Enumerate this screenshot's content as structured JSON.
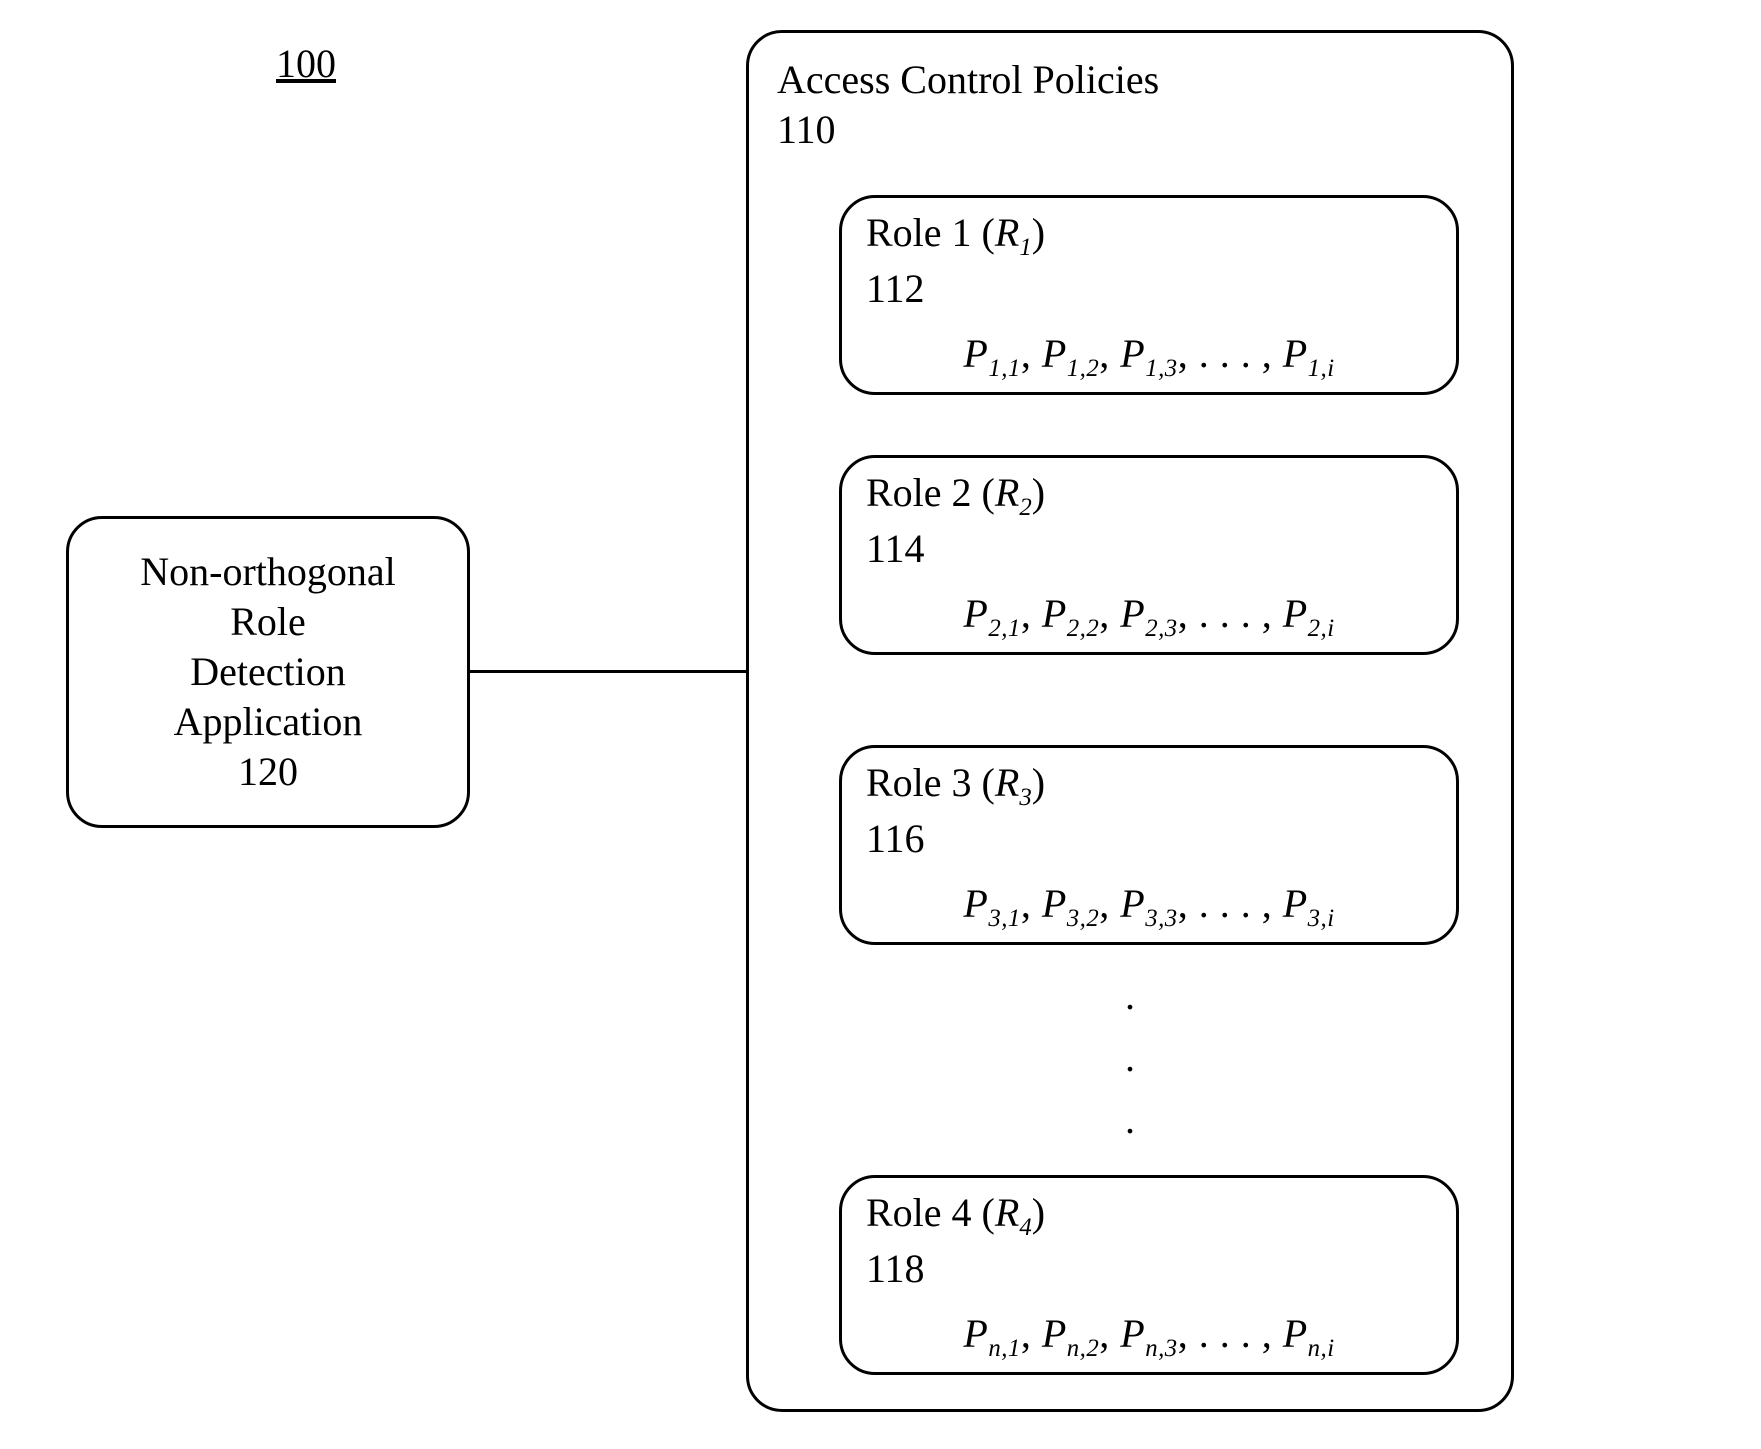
{
  "figure_number": "100",
  "app": {
    "line1": "Non-orthogonal Role",
    "line2": "Detection",
    "line3": "Application",
    "ref": "120"
  },
  "policies": {
    "title": "Access Control Policies",
    "ref": "110",
    "roles": [
      {
        "label_prefix": "Role 1 (",
        "symbol": "R",
        "symbol_sub": "1",
        "label_suffix": ")",
        "ref": "112",
        "perm_base": "P",
        "perm_subs": [
          "1,1",
          "1,2",
          "1,3",
          "1,i"
        ],
        "ellipsis": ". . . ,"
      },
      {
        "label_prefix": "Role 2 (",
        "symbol": "R",
        "symbol_sub": "2",
        "label_suffix": ")",
        "ref": "114",
        "perm_base": "P",
        "perm_subs": [
          "2,1",
          "2,2",
          "2,3",
          "2,i"
        ],
        "ellipsis": ". . . ,"
      },
      {
        "label_prefix": "Role 3 (",
        "symbol": "R",
        "symbol_sub": "3",
        "label_suffix": ")",
        "ref": "116",
        "perm_base": "P",
        "perm_subs": [
          "3,1",
          "3,2",
          "3,3",
          "3,i"
        ],
        "ellipsis": ". . . ,"
      },
      {
        "label_prefix": "Role 4 (",
        "symbol": "R",
        "symbol_sub": "4",
        "label_suffix": ")",
        "ref": "118",
        "perm_base": "P",
        "perm_subs": [
          "n,1",
          "n,2",
          "n,3",
          "n,i"
        ],
        "ellipsis": ". . . ,"
      }
    ],
    "vdots": "."
  }
}
